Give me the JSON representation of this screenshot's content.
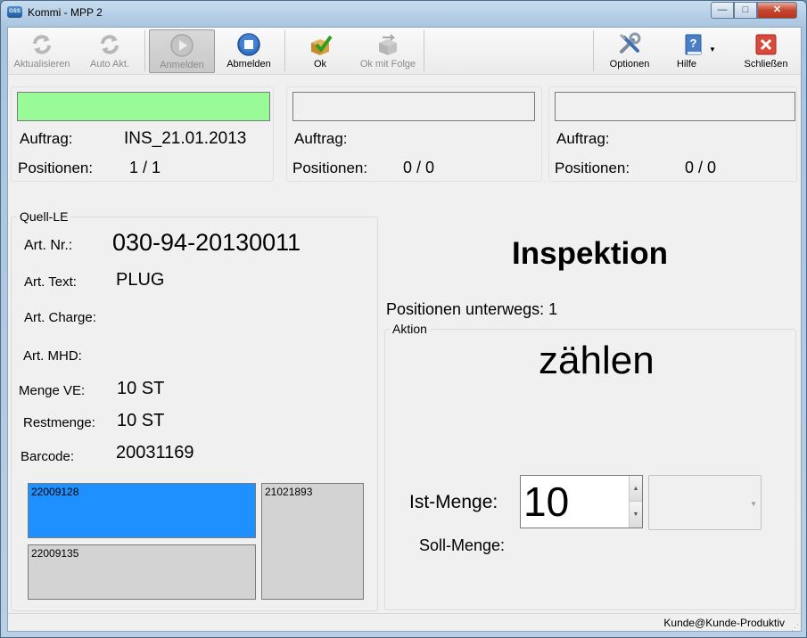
{
  "window": {
    "title": "Kommi - MPP 2",
    "app_icon_text": "GSS",
    "min_symbol": "—",
    "max_symbol": "□",
    "close_symbol": "✕"
  },
  "toolbar": {
    "aktualisieren": "Aktualisieren",
    "auto_akt": "Auto Akt.",
    "anmelden": "Anmelden",
    "abmelden": "Abmelden",
    "ok": "Ok",
    "ok_mit_folge": "Ok mit Folge",
    "optionen": "Optionen",
    "hilfe": "Hilfe",
    "schliessen": "Schließen"
  },
  "slots": [
    {
      "status_color": "#98fb98",
      "auftrag_label": "Auftrag:",
      "auftrag_value": "INS_21.01.2013",
      "positionen_label": "Positionen:",
      "positionen_value": "1 / 1"
    },
    {
      "status_color": "#f0f0f0",
      "auftrag_label": "Auftrag:",
      "auftrag_value": "",
      "positionen_label": "Positionen:",
      "positionen_value": "0 / 0"
    },
    {
      "status_color": "#f0f0f0",
      "auftrag_label": "Auftrag:",
      "auftrag_value": "",
      "positionen_label": "Positionen:",
      "positionen_value": "0 / 0"
    }
  ],
  "quell_le": {
    "title": "Quell-LE",
    "art_nr_label": "Art. Nr.:",
    "art_nr_value": "030-94-20130011",
    "art_text_label": "Art. Text:",
    "art_text_value": "PLUG",
    "art_charge_label": "Art. Charge:",
    "art_charge_value": "",
    "art_mhd_label": "Art. MHD:",
    "art_mhd_value": "",
    "menge_ve_label": "Menge VE:",
    "menge_ve_value": "10 ST",
    "restmenge_label": "Restmenge:",
    "restmenge_value": "10 ST",
    "barcode_label": "Barcode:",
    "barcode_value": "20031169",
    "le_tiles": [
      "22009128",
      "21021893",
      "22009135"
    ],
    "selected_tile": "22009128"
  },
  "main": {
    "title": "Inspektion",
    "positionen_unterwegs": "Positionen unterwegs: 1",
    "aktion_title": "Aktion",
    "aktion_value": "zählen",
    "ist_menge_label": "Ist-Menge:",
    "ist_menge_value": "10",
    "soll_menge_label": "Soll-Menge:",
    "unit_select_value": ""
  },
  "statusbar": {
    "user": "Kunde@Kunde-Produktiv"
  },
  "colors": {
    "slot_active": "#98fb98",
    "tile_selected": "#1e90ff",
    "tile_default": "#d3d3d3"
  }
}
